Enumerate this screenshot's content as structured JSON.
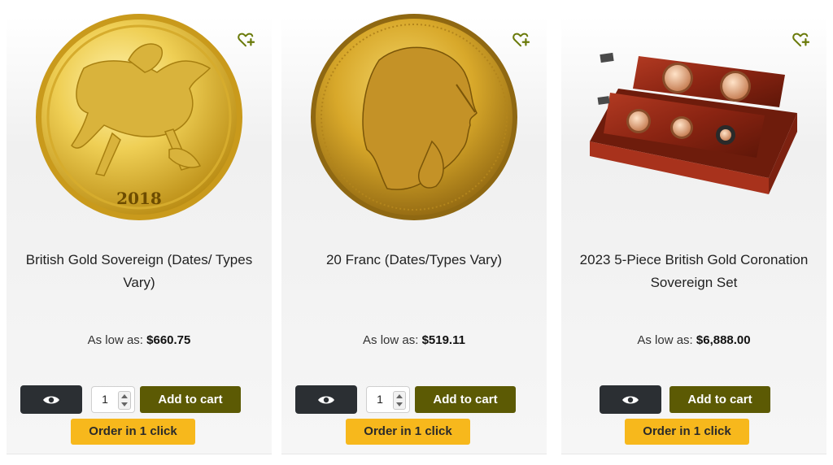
{
  "products": [
    {
      "title": "British Gold Sovereign (Dates/ Types Vary)",
      "price_label": "As low as:",
      "price": "$660.75",
      "coin_year": "2018",
      "quantity": "1",
      "add_to_cart": "Add to cart",
      "order_one_click": "Order in 1 click",
      "icons": [
        "heart-plus-icon",
        "eye-icon"
      ]
    },
    {
      "title": "20 Franc (Dates/Types Vary)",
      "price_label": "As low as:",
      "price": "$519.11",
      "quantity": "1",
      "add_to_cart": "Add to cart",
      "order_one_click": "Order in 1 click",
      "icons": [
        "heart-plus-icon",
        "eye-icon"
      ]
    },
    {
      "title": "2023 5-Piece British Gold Coronation Sovereign Set",
      "price_label": "As low as:",
      "price": "$6,888.00",
      "add_to_cart": "Add to cart",
      "order_one_click": "Order in 1 click",
      "icons": [
        "heart-plus-icon",
        "eye-icon"
      ]
    }
  ],
  "colors": {
    "add_to_cart_bg": "#5c5a04",
    "order_btn_bg": "#f7b81c",
    "view_btn_bg": "#2b2f33",
    "wishlist_icon": "#6a7a0a"
  }
}
